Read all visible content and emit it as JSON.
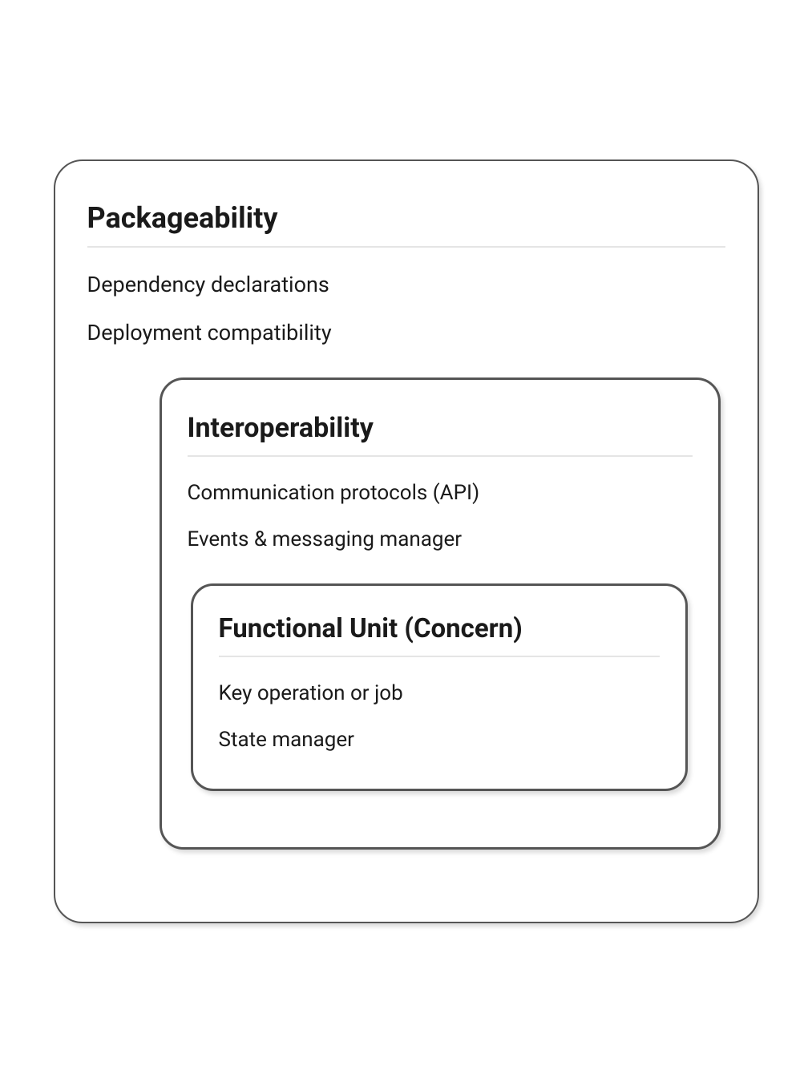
{
  "outer": {
    "title": "Packageability",
    "items": [
      "Dependency declarations",
      "Deployment compatibility"
    ]
  },
  "middle": {
    "title": "Interoperability",
    "items": [
      "Communication protocols (API)",
      "Events & messaging manager"
    ]
  },
  "inner": {
    "title": "Functional Unit (Concern)",
    "items": [
      "Key operation or job",
      "State manager"
    ]
  }
}
